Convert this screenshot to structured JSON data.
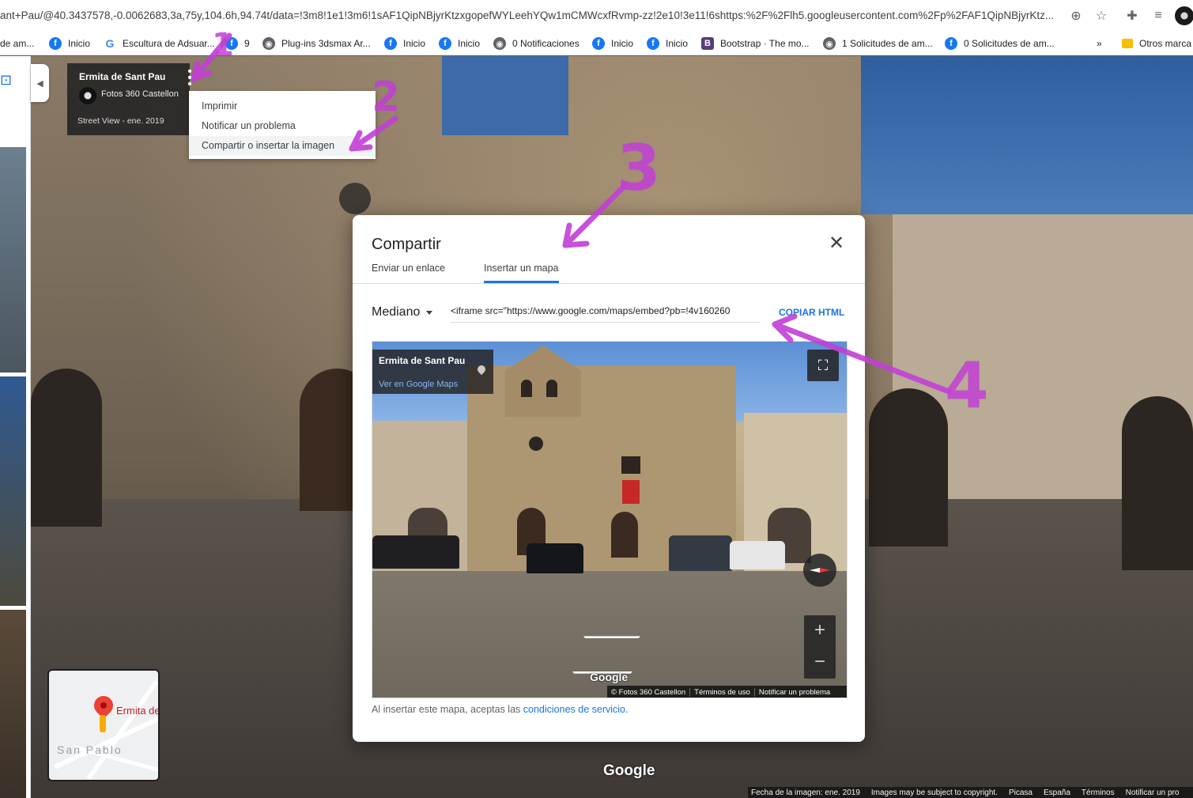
{
  "browser": {
    "url": "ant+Pau/@40.3437578,-0.0062683,3a,75y,104.6h,94.74t/data=!3m8!1e1!3m6!1sAF1QipNBjyrKtzxgopefWYLeehYQw1mCMWcxfRvmp-zz!2e10!3e11!6shttps:%2F%2Flh5.googleusercontent.com%2Fp%2FAF1QipNBjyrKtz...",
    "bookmarks": [
      {
        "label": "de am...",
        "icon": "facebook-icon"
      },
      {
        "label": "Inicio",
        "icon": "facebook-icon"
      },
      {
        "label": "Escultura de Adsuar...",
        "icon": "google-icon"
      },
      {
        "label": "9",
        "icon": "facebook-icon"
      },
      {
        "label": "Plug-ins 3dsmax Ar...",
        "icon": "globe-icon"
      },
      {
        "label": "Inicio",
        "icon": "facebook-icon"
      },
      {
        "label": "Inicio",
        "icon": "facebook-icon"
      },
      {
        "label": "0 Notificaciones",
        "icon": "globe-icon"
      },
      {
        "label": "Inicio",
        "icon": "facebook-icon"
      },
      {
        "label": "Inicio",
        "icon": "facebook-icon"
      },
      {
        "label": "Bootstrap · The mo...",
        "icon": "bootstrap-icon"
      },
      {
        "label": "1 Solicitudes de am...",
        "icon": "globe-icon"
      },
      {
        "label": "0 Solicitudes de am...",
        "icon": "facebook-icon"
      }
    ],
    "overflow": "»",
    "other_bookmarks": "Otros marca"
  },
  "info_card": {
    "title": "Ermita de Sant Pau",
    "author": "Fotos 360 Castellon",
    "date": "Street View - ene. 2019"
  },
  "context_menu": {
    "items": [
      "Imprimir",
      "Notificar un problema",
      "Compartir o insertar la imagen"
    ]
  },
  "minimap": {
    "place_label": "Ermita de",
    "area_label": "San Pablo"
  },
  "scene": {
    "google_logo": "Google",
    "footer": [
      "Fecha de la imagen: ene. 2019",
      "Images may be subject to copyright.",
      "Picasa",
      "España",
      "Términos",
      "Notificar un pro"
    ]
  },
  "dialog": {
    "title": "Compartir",
    "tabs": [
      "Enviar un enlace",
      "Insertar un mapa"
    ],
    "size_value": "Mediano",
    "embed_code": "<iframe src=\"https://www.google.com/maps/embed?pb=!4v160260",
    "copy_label": "COPIAR HTML",
    "preview": {
      "title": "Ermita de Sant Pau",
      "link": "Ver en Google Maps",
      "google": "Google",
      "footer": [
        "© Fotos 360 Castellon",
        "Términos de uso",
        "Notificar un problema"
      ],
      "zoom_in": "+",
      "zoom_out": "−"
    },
    "consent_text": "Al insertar este mapa, aceptas las ",
    "consent_link": "condiciones de servicio",
    "consent_end": "."
  },
  "annotations": [
    "1",
    "2",
    "3",
    "4"
  ],
  "colors": {
    "accent": "#1a73e8",
    "annotation": "#c23fd6"
  }
}
